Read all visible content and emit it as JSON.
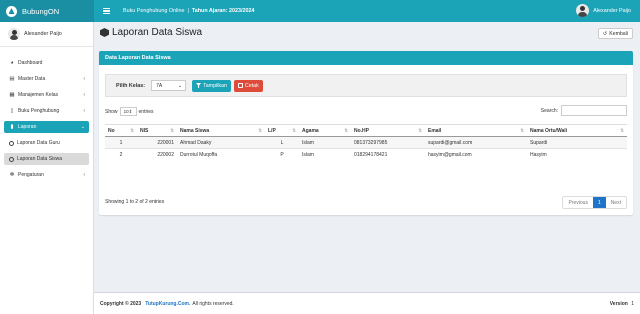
{
  "brand": {
    "name": "BubungON"
  },
  "topbar": {
    "school": "Buku Penghubung Online",
    "separator": "|",
    "academic_year": "Tahun Ajaran: 2023/2024",
    "user_name": "Alexander Paijo"
  },
  "sidebar": {
    "user_name": "Alexander Paijo",
    "items": [
      {
        "label": "Dashboard",
        "icon": "dashboard-icon"
      },
      {
        "label": "Master Data",
        "icon": "database-icon"
      },
      {
        "label": "Manajemen Kelas",
        "icon": "class-icon"
      },
      {
        "label": "Buku Penghubung",
        "icon": "book-icon"
      },
      {
        "label": "Laporan",
        "icon": "report-icon"
      },
      {
        "label": "Laporan Data Guru",
        "icon": "circle-icon"
      },
      {
        "label": "Laporan Data Siswa",
        "icon": "circle-icon"
      },
      {
        "label": "Pengaturan",
        "icon": "gear-icon"
      }
    ]
  },
  "page": {
    "title": "Laporan Data Siswa",
    "back_label": "Kembali"
  },
  "box": {
    "title": "Data Laporan Data Siswa"
  },
  "filter": {
    "label": "Pilih Kelas:",
    "selected": "7A",
    "show_label": "Tampilkan",
    "print_label": "Cetak"
  },
  "datatable": {
    "show_label": "Show",
    "entries_value": "10",
    "entries_label": "entries",
    "search_label": "Search:",
    "info": "Showing 1 to 2 of 2 entries",
    "prev_label": "Previous",
    "page": "1",
    "next_label": "Next"
  },
  "table": {
    "headers": [
      "No",
      "NIS",
      "Nama Siswa",
      "L/P",
      "Agama",
      "No.HP",
      "Email",
      "Nama Ortu/Wali"
    ],
    "rows": [
      [
        "1",
        "220001",
        "Ahmad Daaky",
        "L",
        "Islam",
        "081373297985",
        "supardi@gmail.com",
        "Supardi"
      ],
      [
        "2",
        "220002",
        "Durrotul Muqoffa",
        "P",
        "Islam",
        "018294178421",
        "hasyim@gmail.com",
        "Hasyim"
      ]
    ]
  },
  "footer": {
    "copyright": "Copyright © 2023",
    "link": "TutupKurung.Com.",
    "rights": "All rights reserved.",
    "version_label": "Version",
    "version": "1"
  },
  "colors": {
    "primary": "#1ba3b8",
    "danger": "#dd4b39",
    "pager_active": "#1e74c8"
  }
}
